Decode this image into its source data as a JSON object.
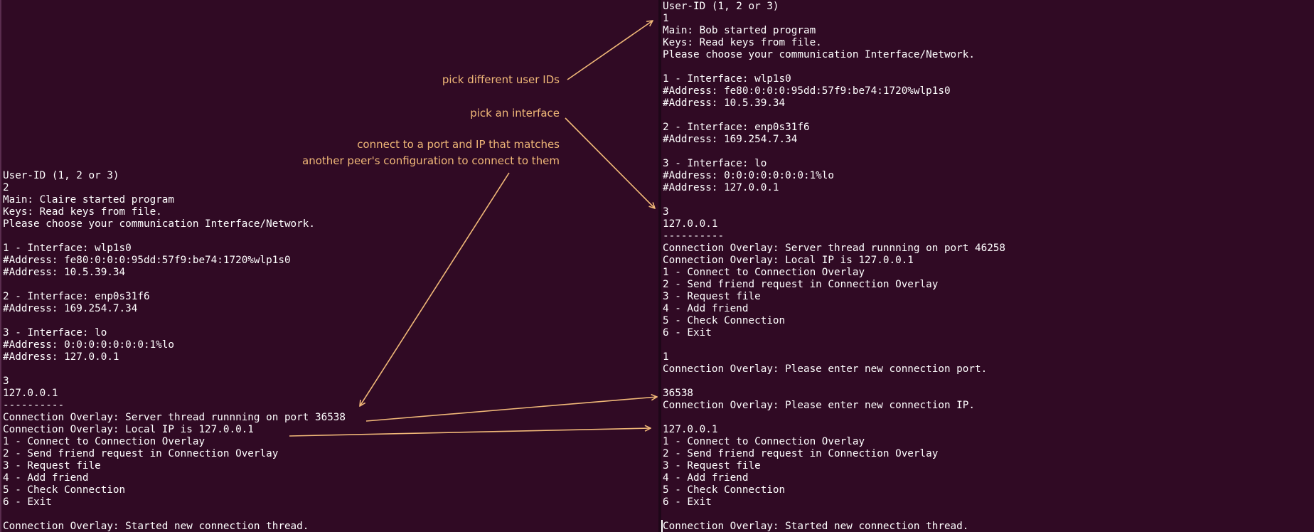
{
  "left_terminal": {
    "lines": [
      "User-ID (1, 2 or 3)",
      "2",
      "Main: Claire started program",
      "Keys: Read keys from file.",
      "Please choose your communication Interface/Network.",
      "",
      "1 - Interface: wlp1s0",
      "#Address: fe80:0:0:0:95dd:57f9:be74:1720%wlp1s0",
      "#Address: 10.5.39.34",
      "",
      "2 - Interface: enp0s31f6",
      "#Address: 169.254.7.34",
      "",
      "3 - Interface: lo",
      "#Address: 0:0:0:0:0:0:0:1%lo",
      "#Address: 127.0.0.1",
      "",
      "3",
      "127.0.0.1",
      "----------",
      "Connection Overlay: Server thread runnning on port 36538",
      "Connection Overlay: Local IP is 127.0.0.1",
      "1 - Connect to Connection Overlay",
      "2 - Send friend request in Connection Overlay",
      "3 - Request file",
      "4 - Add friend",
      "5 - Check Connection",
      "6 - Exit",
      "",
      "Connection Overlay: Started new connection thread."
    ]
  },
  "right_terminal": {
    "lines": [
      "User-ID (1, 2 or 3)",
      "1",
      "Main: Bob started program",
      "Keys: Read keys from file.",
      "Please choose your communication Interface/Network.",
      "",
      "1 - Interface: wlp1s0",
      "#Address: fe80:0:0:0:95dd:57f9:be74:1720%wlp1s0",
      "#Address: 10.5.39.34",
      "",
      "2 - Interface: enp0s31f6",
      "#Address: 169.254.7.34",
      "",
      "3 - Interface: lo",
      "#Address: 0:0:0:0:0:0:0:1%lo",
      "#Address: 127.0.0.1",
      "",
      "3",
      "127.0.0.1",
      "----------",
      "Connection Overlay: Server thread runnning on port 46258",
      "Connection Overlay: Local IP is 127.0.0.1",
      "1 - Connect to Connection Overlay",
      "2 - Send friend request in Connection Overlay",
      "3 - Request file",
      "4 - Add friend",
      "5 - Check Connection",
      "6 - Exit",
      "",
      "1",
      "Connection Overlay: Please enter new connection port.",
      "",
      "36538",
      "Connection Overlay: Please enter new connection IP.",
      "",
      "127.0.0.1",
      "1 - Connect to Connection Overlay",
      "2 - Send friend request in Connection Overlay",
      "3 - Request file",
      "4 - Add friend",
      "5 - Check Connection",
      "6 - Exit",
      "",
      "Connection Overlay: Started new connection thread."
    ]
  },
  "annotations": {
    "user_ids": "pick different user IDs",
    "interface": "pick an interface",
    "connect_line1": "connect to a port and IP that matches",
    "connect_line2": "another peer's configuration to connect to them"
  },
  "colors": {
    "background": "#300a24",
    "text": "#ffffff",
    "annotation": "#f0b878"
  }
}
